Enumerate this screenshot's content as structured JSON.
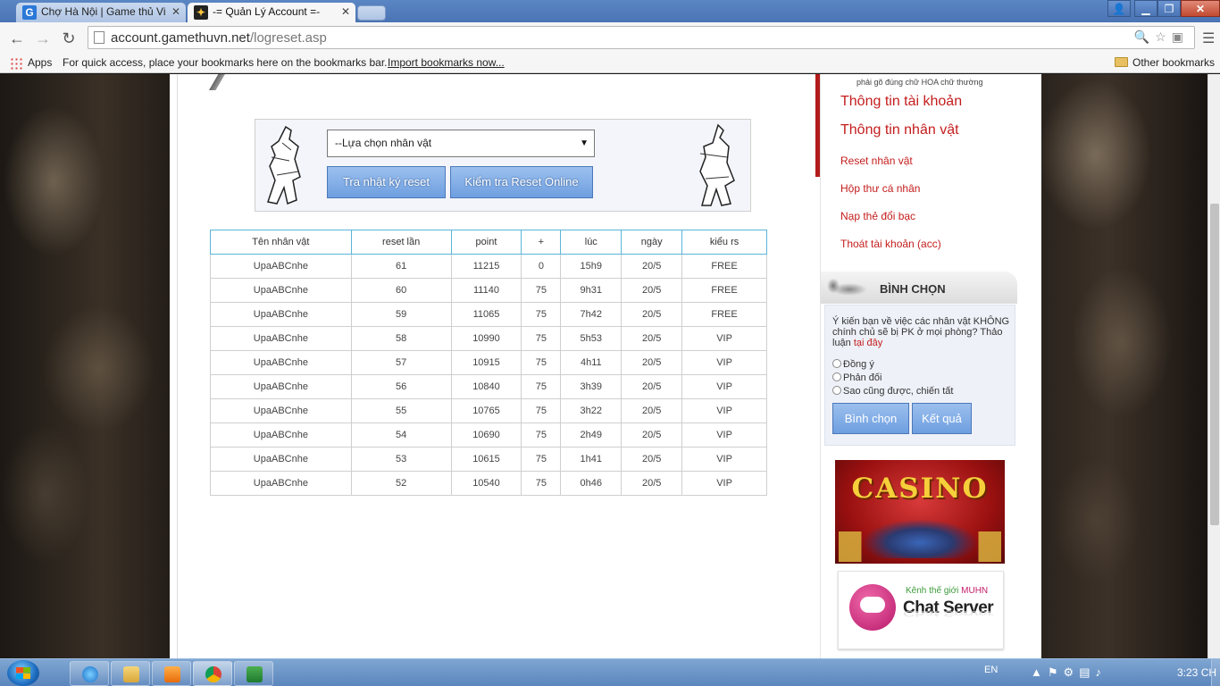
{
  "browser": {
    "tabs": [
      {
        "label": "Chợ Hà Nội | Game thủ Vi",
        "favicon": "G",
        "active": false
      },
      {
        "label": "-= Quản Lý Account =-",
        "favicon": "",
        "active": true
      }
    ],
    "url_host": "account.gamethuvn.net",
    "url_path": "/logreset.asp",
    "bookmarks": {
      "apps_label": "Apps",
      "tip": "For quick access, place your bookmarks here on the bookmarks bar.",
      "import_link": "Import bookmarks now...",
      "other": "Other bookmarks"
    }
  },
  "page": {
    "select": {
      "placeholder": "--Lựa chọn nhân vật"
    },
    "buttons": {
      "view_log": "Tra nhật ký reset",
      "check_online": "Kiểm tra Reset Online"
    },
    "table": {
      "headers": [
        "Tên nhân vật",
        "reset lần",
        "point",
        "+",
        "lúc",
        "ngày",
        "kiểu rs"
      ],
      "rows": [
        [
          "UpaABCnhe",
          "61",
          "11215",
          "0",
          "15h9",
          "20/5",
          "FREE"
        ],
        [
          "UpaABCnhe",
          "60",
          "11140",
          "75",
          "9h31",
          "20/5",
          "FREE"
        ],
        [
          "UpaABCnhe",
          "59",
          "11065",
          "75",
          "7h42",
          "20/5",
          "FREE"
        ],
        [
          "UpaABCnhe",
          "58",
          "10990",
          "75",
          "5h53",
          "20/5",
          "VIP"
        ],
        [
          "UpaABCnhe",
          "57",
          "10915",
          "75",
          "4h11",
          "20/5",
          "VIP"
        ],
        [
          "UpaABCnhe",
          "56",
          "10840",
          "75",
          "3h39",
          "20/5",
          "VIP"
        ],
        [
          "UpaABCnhe",
          "55",
          "10765",
          "75",
          "3h22",
          "20/5",
          "VIP"
        ],
        [
          "UpaABCnhe",
          "54",
          "10690",
          "75",
          "2h49",
          "20/5",
          "VIP"
        ],
        [
          "UpaABCnhe",
          "53",
          "10615",
          "75",
          "1h41",
          "20/5",
          "VIP"
        ],
        [
          "UpaABCnhe",
          "52",
          "10540",
          "75",
          "0h46",
          "20/5",
          "VIP"
        ]
      ]
    }
  },
  "sidebar": {
    "note": "phải gõ đúng chữ HOA chữ thường",
    "account_links": [
      {
        "label": "Thông tin tài khoản",
        "size": "big"
      },
      {
        "label": "Thông tin nhân vật",
        "size": "big"
      },
      {
        "label": "Reset nhân vật",
        "size": "small"
      },
      {
        "label": "Hộp thư cá nhân",
        "size": "small"
      },
      {
        "label": "Nạp thẻ đổi bạc",
        "size": "small"
      },
      {
        "label": "Thoát tài khoản (acc)",
        "size": "small"
      }
    ],
    "poll": {
      "title": "BÌNH CHỌN",
      "question": "Ý kiến bạn về việc các nhân vật KHÔNG chính chủ sẽ bị PK ở mọi phòng? Thảo luận",
      "question_link": "tại đây",
      "options": [
        "Đồng ý",
        "Phản đối",
        "Sao cũng được, chiến tất"
      ],
      "vote_button": "Bình chọn",
      "result_button": "Kết quả"
    },
    "banners": {
      "casino_text": "CASINO",
      "chat_channel": "Kênh thế giới",
      "chat_brand": "MUHN",
      "chat_title": "Chat Server"
    }
  },
  "taskbar": {
    "lang": "EN",
    "clock": "3:23 CH"
  },
  "colors": {
    "link_red": "#c41d1d",
    "button_blue": "#6e9fe0",
    "table_header_border": "#5ab6d8"
  }
}
